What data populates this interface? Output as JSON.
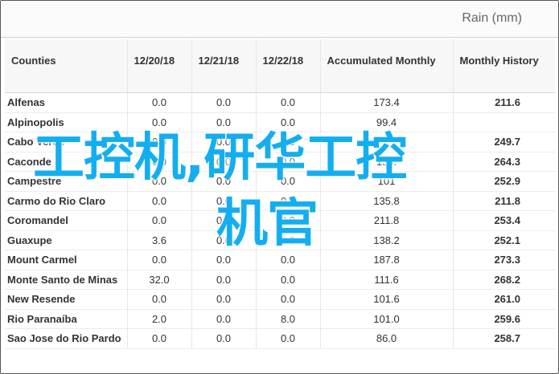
{
  "caption": "Rain (mm)",
  "columns": [
    "Counties",
    "12/20/18",
    "12/21/18",
    "12/22/18",
    "Accumulated Monthly",
    "Monthly History"
  ],
  "rows": [
    {
      "county": "Alfenas",
      "d1": "0.0",
      "d2": "0.0",
      "d3": "0.0",
      "acc": "173.4",
      "hist": "211.6"
    },
    {
      "county": "Alpinopolis",
      "d1": "0.0",
      "d2": "0.0",
      "d3": "0.0",
      "acc": "99.4",
      "hist": ""
    },
    {
      "county": "Cabo Verde",
      "d1": "0.0",
      "d2": "0.0",
      "d3": "0.0",
      "acc": "",
      "hist": "249.7"
    },
    {
      "county": "Caconde",
      "d1": "0.0",
      "d2": "0.0",
      "d3": "0.0",
      "acc": "155.",
      "hist": "264.3"
    },
    {
      "county": "Campestre",
      "d1": "0.0",
      "d2": "0.0",
      "d3": "0.0",
      "acc": "101",
      "hist": "252.9"
    },
    {
      "county": "Carmo do Rio Claro",
      "d1": "0.0",
      "d2": "0.0",
      "d3": "0.0",
      "acc": "135.8",
      "hist": "211.8"
    },
    {
      "county": "Coromandel",
      "d1": "0.0",
      "d2": "0.0",
      "d3": "0.0",
      "acc": "211.8",
      "hist": "253.4"
    },
    {
      "county": "Guaxupe",
      "d1": "3.6",
      "d2": "0.0",
      "d3": "0.0",
      "acc": "138.2",
      "hist": "252.1"
    },
    {
      "county": "Mount Carmel",
      "d1": "0.0",
      "d2": "0.0",
      "d3": "0.0",
      "acc": "187.8",
      "hist": "273.3"
    },
    {
      "county": "Monte Santo de Minas",
      "d1": "32.0",
      "d2": "0.0",
      "d3": "0.0",
      "acc": "111.6",
      "hist": "268.2"
    },
    {
      "county": "New Resende",
      "d1": "0.0",
      "d2": "0.0",
      "d3": "0.0",
      "acc": "101.6",
      "hist": "261.0"
    },
    {
      "county": "Rio Paranaíba",
      "d1": "2.0",
      "d2": "0.0",
      "d3": "8.0",
      "acc": "101.0",
      "hist": "259.6"
    },
    {
      "county": "Sao Jose do Rio Pardo",
      "d1": "0.0",
      "d2": "0.0",
      "d3": "0.0",
      "acc": "86.0",
      "hist": "258.7"
    }
  ],
  "watermark": {
    "line1": "工控机,研华工控",
    "line2": "机官"
  },
  "colors": {
    "watermark": "#14aef0",
    "border": "#555555"
  }
}
